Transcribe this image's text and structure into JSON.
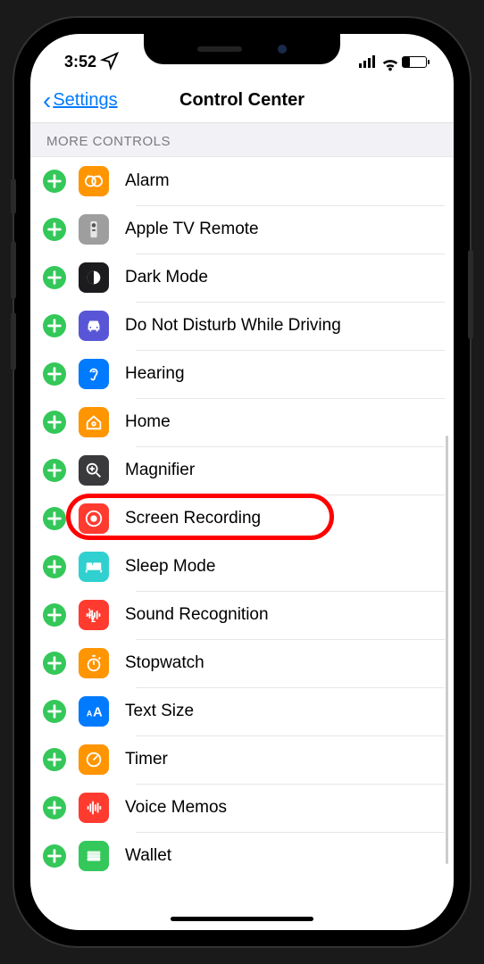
{
  "status": {
    "time": "3:52",
    "location_icon": "location-arrow"
  },
  "nav": {
    "back_label": "Settings",
    "title": "Control Center"
  },
  "section": {
    "header": "MORE CONTROLS"
  },
  "controls": [
    {
      "id": "alarm",
      "label": "Alarm",
      "icon": "clock-icon",
      "color": "ic-alarm"
    },
    {
      "id": "apple-tv-remote",
      "label": "Apple TV Remote",
      "icon": "tv-remote-icon",
      "color": "ic-tv"
    },
    {
      "id": "dark-mode",
      "label": "Dark Mode",
      "icon": "dark-mode-icon",
      "color": "ic-dark"
    },
    {
      "id": "dnd-driving",
      "label": "Do Not Disturb While Driving",
      "icon": "car-icon",
      "color": "ic-dnd"
    },
    {
      "id": "hearing",
      "label": "Hearing",
      "icon": "ear-icon",
      "color": "ic-hearing"
    },
    {
      "id": "home",
      "label": "Home",
      "icon": "house-icon",
      "color": "ic-home"
    },
    {
      "id": "magnifier",
      "label": "Magnifier",
      "icon": "magnify-icon",
      "color": "ic-mag"
    },
    {
      "id": "screen-recording",
      "label": "Screen Recording",
      "icon": "record-icon",
      "color": "ic-rec",
      "highlighted": true
    },
    {
      "id": "sleep-mode",
      "label": "Sleep Mode",
      "icon": "bed-icon",
      "color": "ic-sleep"
    },
    {
      "id": "sound-recognition",
      "label": "Sound Recognition",
      "icon": "waveform-icon",
      "color": "ic-sound"
    },
    {
      "id": "stopwatch",
      "label": "Stopwatch",
      "icon": "stopwatch-icon",
      "color": "ic-stop"
    },
    {
      "id": "text-size",
      "label": "Text Size",
      "icon": "text-size-icon",
      "color": "ic-text"
    },
    {
      "id": "timer",
      "label": "Timer",
      "icon": "timer-icon",
      "color": "ic-timer"
    },
    {
      "id": "voice-memos",
      "label": "Voice Memos",
      "icon": "voice-memo-icon",
      "color": "ic-voice"
    },
    {
      "id": "wallet",
      "label": "Wallet",
      "icon": "wallet-icon",
      "color": "ic-wallet"
    }
  ]
}
